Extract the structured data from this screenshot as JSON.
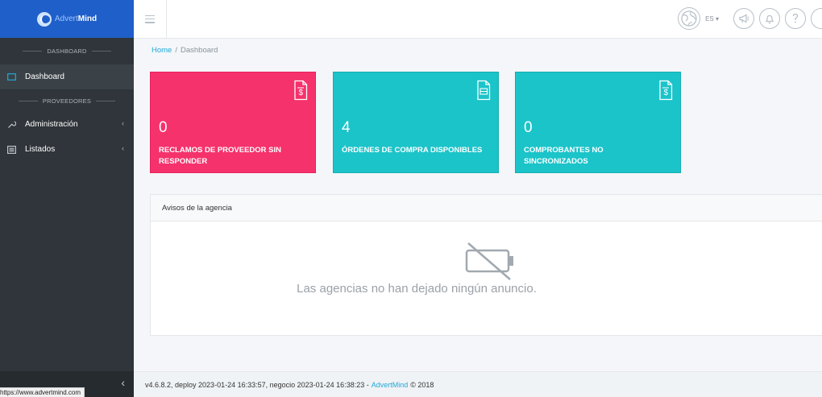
{
  "brand": {
    "name_prefix": "Advert",
    "name_suffix": "Mind"
  },
  "sidebar": {
    "sections": [
      {
        "title": "DASHBOARD"
      },
      {
        "title": "PROVEEDORES"
      }
    ],
    "items": [
      {
        "label": "Dashboard",
        "icon": "monitor-icon",
        "active": true
      },
      {
        "label": "Administración",
        "icon": "wrench-icon"
      },
      {
        "label": "Listados",
        "icon": "list-icon"
      }
    ],
    "minimizer_glyph": "‹"
  },
  "header": {
    "lang": "ES ▾",
    "icons": [
      "globe-icon",
      "megaphone-icon",
      "bell-icon",
      "help-icon"
    ]
  },
  "breadcrumb": {
    "home": "Home",
    "sep": "/",
    "current": "Dashboard"
  },
  "cards": [
    {
      "value": "0",
      "label": "RECLAMOS DE PROVEEDOR SIN RESPONDER",
      "color": "#f5326c"
    },
    {
      "value": "4",
      "label": "ÓRDENES DE COMPRA DISPONIBLES",
      "color": "#1bc4c9"
    },
    {
      "value": "0",
      "label": "COMPROBANTES NO SINCRONIZADOS",
      "color": "#1bc4c9"
    }
  ],
  "notices": {
    "title": "Avisos de la agencia",
    "empty_message": "Las agencias no han dejado ningún anuncio."
  },
  "footer": {
    "text_before": "v4.6.8.2, deploy 2023-01-24 16:33:57, negocio 2023-01-24 16:38:23 -",
    "link": "AdvertMind",
    "text_after": "© 2018"
  },
  "status_url": "https://www.advertmind.com"
}
